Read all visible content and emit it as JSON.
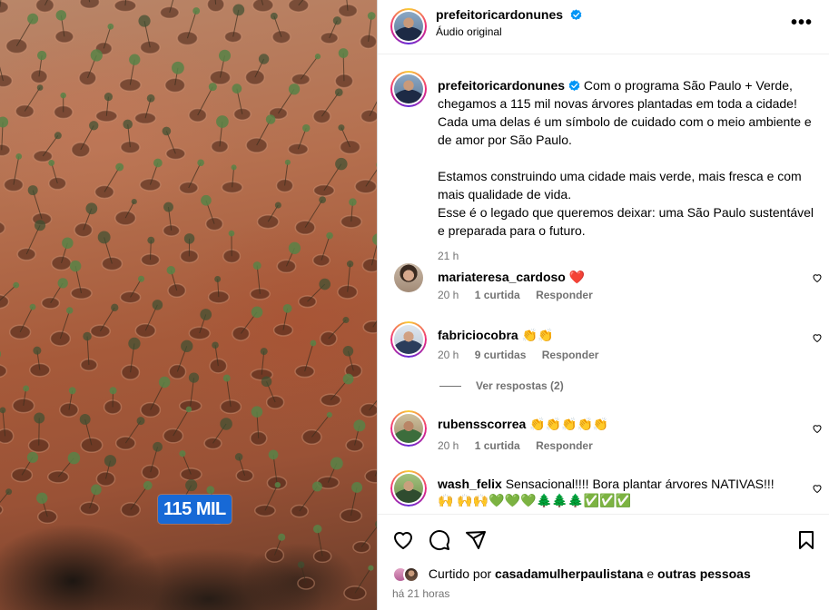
{
  "media": {
    "overlay_label": "115 MIL"
  },
  "header": {
    "username": "prefeitoricardonunes",
    "subtitle": "Áudio original",
    "more_label": "•••"
  },
  "caption": {
    "username": "prefeitoricardonunes",
    "paragraph1": "Com o programa São Paulo + Verde, chegamos a 115 mil novas árvores plantadas em toda a cidade! Cada uma delas é um símbolo de cuidado com o meio ambiente e de amor por São Paulo.",
    "paragraph2": "Estamos construindo uma cidade mais verde, mais fresca e com mais qualidade de vida.",
    "paragraph3": "Esse é o legado que queremos deixar: uma São Paulo sustentável e preparada para o futuro.",
    "time": "21 h"
  },
  "comments": [
    {
      "username": "mariateresa_cardoso",
      "text": "❤️",
      "time": "20 h",
      "likes": "1 curtida",
      "reply": "Responder"
    },
    {
      "username": "fabriciocobra",
      "text": "👏👏",
      "time": "20 h",
      "likes": "9 curtidas",
      "reply": "Responder"
    },
    {
      "username": "rubensscorrea",
      "text": "👏👏👏👏👏",
      "time": "20 h",
      "likes": "1 curtida",
      "reply": "Responder"
    },
    {
      "username": "wash_felix",
      "text": "Sensacional!!!! Bora plantar árvores NATIVAS!!! 🙌 🙌🙌💚💚💚🌲🌲🌲✅✅✅"
    }
  ],
  "view_replies": "Ver respostas (2)",
  "likes_line": {
    "prefix": "Curtido por",
    "user": "casadamulherpaulistana",
    "connector": "e",
    "others": "outras pessoas"
  },
  "posted_ago": "há 21 horas",
  "colors": {
    "verified": "#0095f6",
    "badge": "#1769d6",
    "secondary_text": "#737373"
  }
}
